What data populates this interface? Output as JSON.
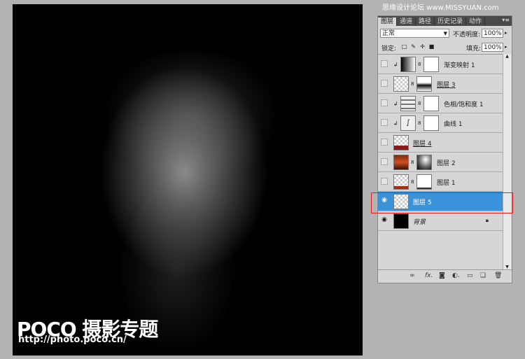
{
  "watermark": "思缘设计论坛 www.MISSYUAN.com",
  "canvas_logo": {
    "main": "POCO 摄影专题",
    "url": "http://photo.poco.cn/"
  },
  "panel": {
    "tabs": [
      "图层",
      "通道",
      "路径",
      "历史记录",
      "动作"
    ],
    "active_tab": "图层",
    "blend_mode": "正常",
    "opacity_label": "不透明度:",
    "opacity_value": "100%",
    "lock_label": "锁定:",
    "fill_label": "填充:",
    "fill_value": "100%",
    "layers": [
      {
        "name": "渐变映射 1",
        "visible": false,
        "clipped": true,
        "selected": false
      },
      {
        "name": "图层 3",
        "visible": false,
        "clipped": false,
        "selected": false
      },
      {
        "name": "色相/饱和度 1",
        "visible": false,
        "clipped": true,
        "selected": false
      },
      {
        "name": "曲线 1",
        "visible": false,
        "clipped": true,
        "selected": false
      },
      {
        "name": "图层 4",
        "visible": false,
        "clipped": false,
        "selected": false
      },
      {
        "name": "图层 2",
        "visible": false,
        "clipped": false,
        "selected": false
      },
      {
        "name": "图层 1",
        "visible": false,
        "clipped": false,
        "selected": false
      },
      {
        "name": "图层 5",
        "visible": true,
        "clipped": false,
        "selected": true
      },
      {
        "name": "背景",
        "visible": true,
        "clipped": false,
        "selected": false,
        "locked": true
      }
    ],
    "bottom_icons": [
      "link-icon",
      "fx-icon",
      "mask-icon",
      "adjustment-icon",
      "group-icon",
      "new-layer-icon",
      "trash-icon"
    ]
  },
  "colors": {
    "selection": "#3a92d8",
    "highlight_box": "#e02020"
  }
}
